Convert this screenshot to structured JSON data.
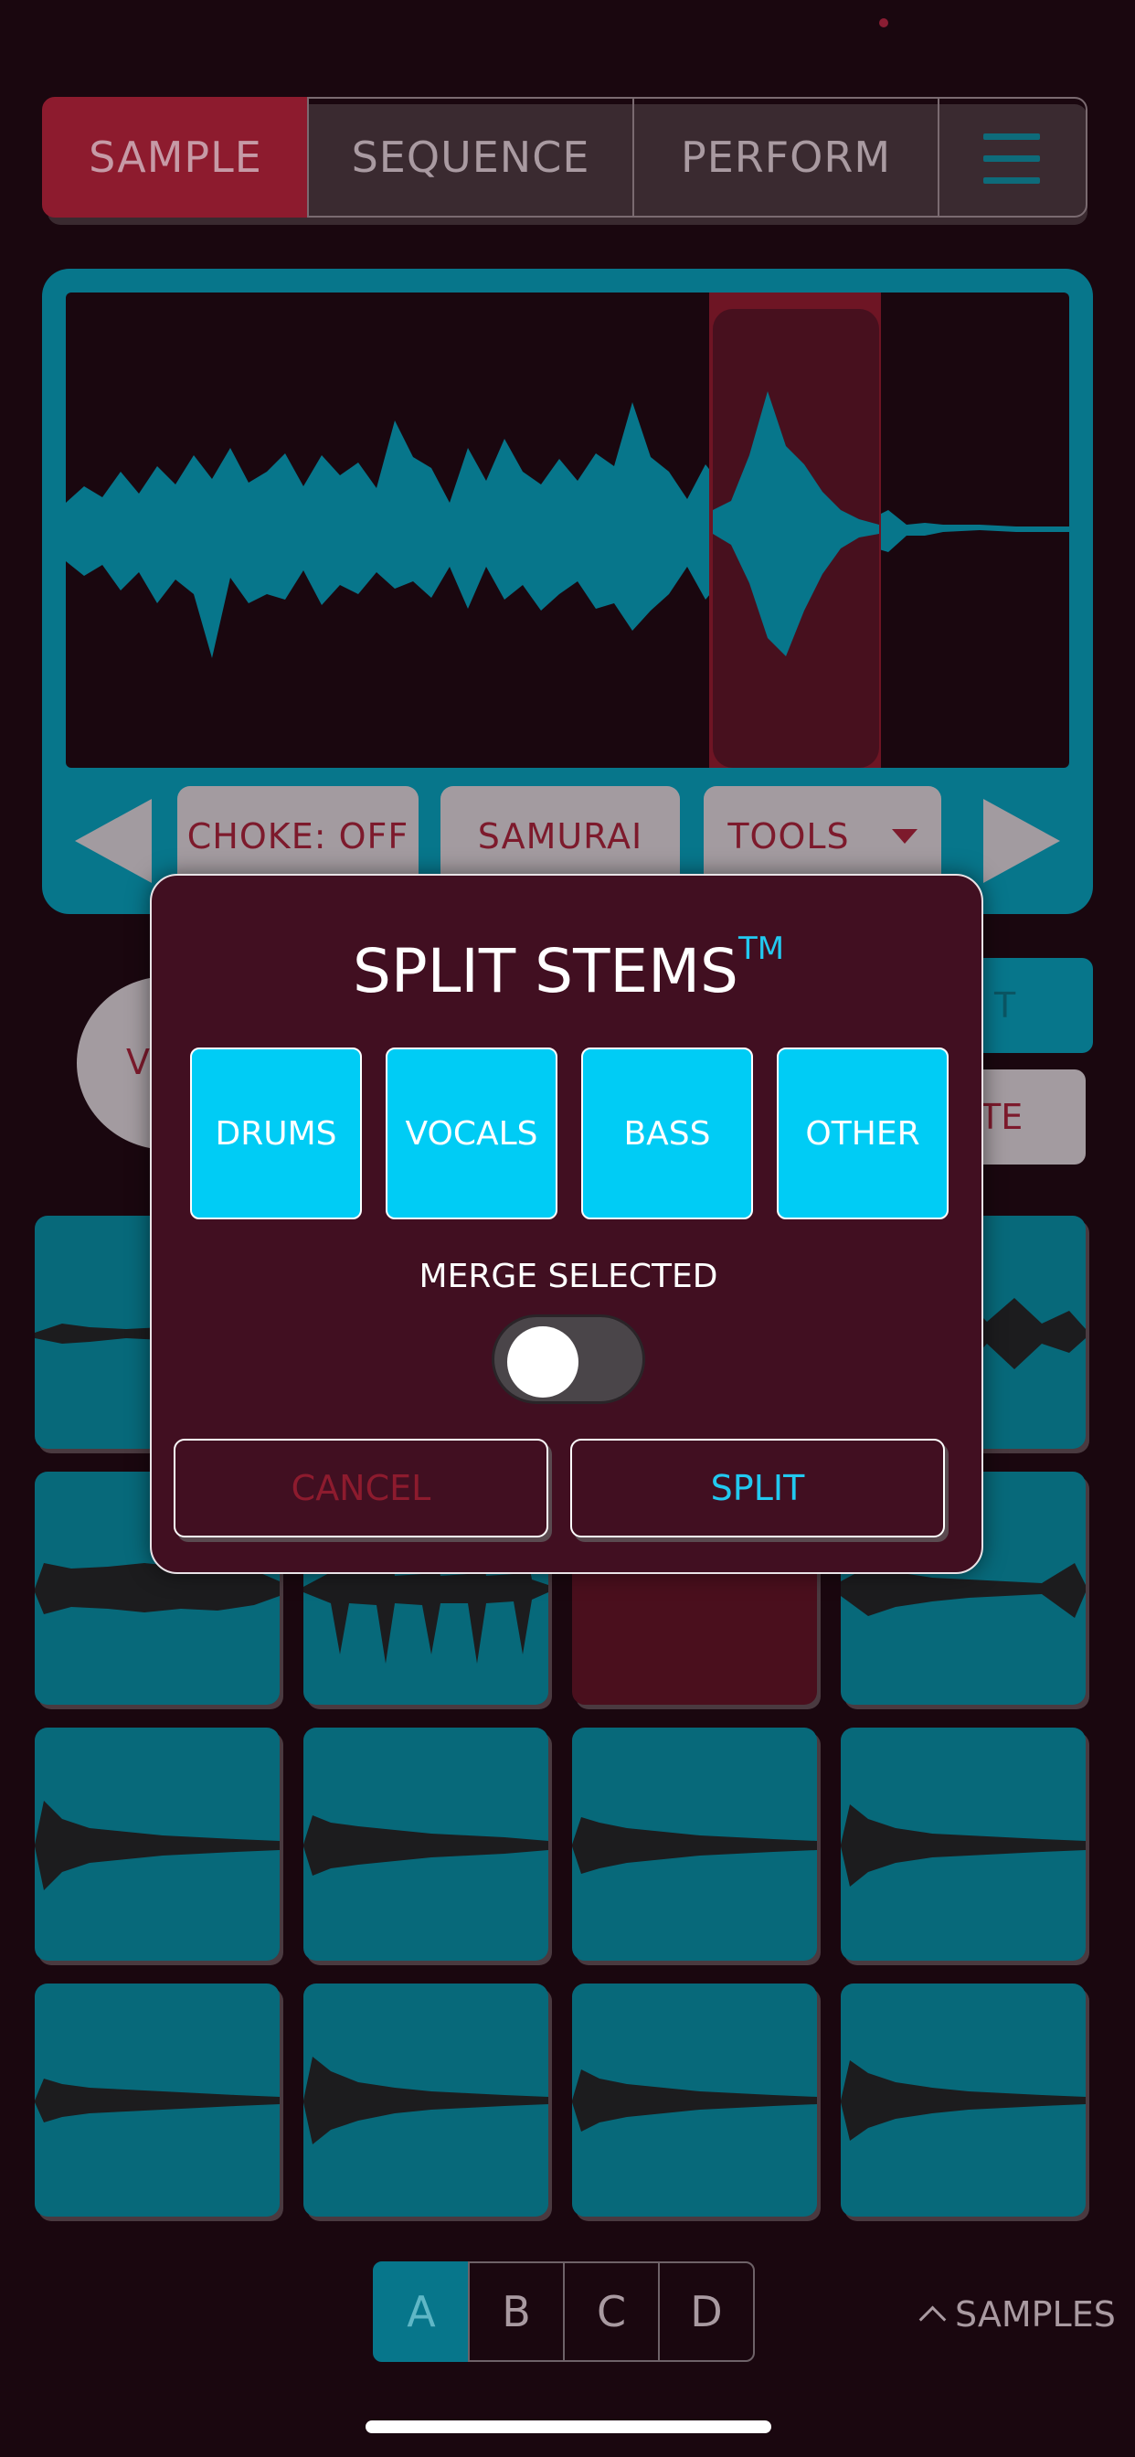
{
  "nav": {
    "tabs": [
      {
        "label": "SAMPLE",
        "active": true
      },
      {
        "label": "SEQUENCE",
        "active": false
      },
      {
        "label": "PERFORM",
        "active": false
      }
    ],
    "menu_icon": "hamburger-menu-icon"
  },
  "waveform": {
    "buttons": {
      "choke": "CHOKE: OFF",
      "mode": "SAMURAI",
      "tools": "TOOLS"
    },
    "prev_icon": "triangle-left-icon",
    "next_icon": "triangle-right-icon"
  },
  "background_controls": {
    "circle_label": "V",
    "side_top": "T",
    "side_bottom": "TE"
  },
  "modal": {
    "title": "SPLIT STEMS",
    "trademark": "TM",
    "stems": [
      "DRUMS",
      "VOCALS",
      "BASS",
      "OTHER"
    ],
    "merge_label": "MERGE SELECTED",
    "merge_enabled": false,
    "cancel_label": "CANCEL",
    "split_label": "SPLIT"
  },
  "banks": {
    "items": [
      "A",
      "B",
      "C",
      "D"
    ],
    "active": "A"
  },
  "samples_link": "SAMPLES",
  "colors": {
    "background": "#1a070f",
    "accent_teal": "#07768b",
    "accent_red": "#8d1b2e",
    "stem_button": "#00ccf5",
    "modal_bg": "#410f21"
  }
}
